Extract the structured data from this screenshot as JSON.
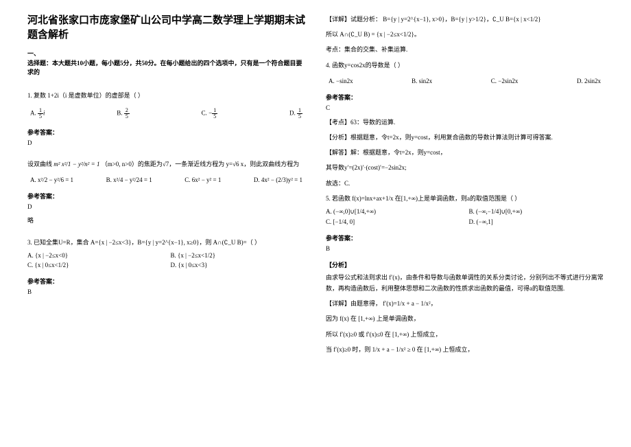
{
  "title": "河北省张家口市庞家堡矿山公司中学高二数学理上学期期末试题含解析",
  "section1": {
    "num": "一、",
    "text": "选择题：本大题共10小题，每小题5分，共50分。在每小题给出的四个选项中，只有是一个符合题目要求的"
  },
  "q1": {
    "stem": "1. 复数 1+2i（i 是虚数单位）的虚部是（    ）",
    "A": "1/5 i",
    "B": "2/5",
    "C": "−1/5",
    "D": "1/5",
    "ans_label": "参考答案：",
    "ans": "D"
  },
  "q2": {
    "stem_pre": "设双曲线",
    "stem_mid": "（m>0, n>0）的焦距为√7，一条渐近线方程为 y=√6 x，则此双曲线方程为",
    "A": "A.  x²/2 − y²/6 = 1",
    "B": "B.  x²/4 − y²/24 = 1",
    "C": "C.  6x² − y² = 1",
    "D": "D.  4x² − (2/3)y² = 1",
    "ans_label": "参考答案：",
    "ans": "D",
    "note": "略"
  },
  "q3": {
    "stem": "3. 已知全集U=R，集合 A={x | −2≤x<3}，B={y | y=2^{x−1}, x≥0}，则 A∩(∁_U B)=（  ）",
    "A": "A.  {x | −2≤x<0}",
    "B": "B.  {x | −2≤x<1/2}",
    "C": "C.  {x | 0≤x<1/2}",
    "D": "D.  {x | 0≤x<3}",
    "ans_label": "参考答案：",
    "ans": "B"
  },
  "right": {
    "detail_label": "【详解】试题分析：",
    "detail_text": "B={y | y=2^{x−1}, x>0}，B={y | y>1/2}，∁_U B={x | x<1/2}",
    "so": "所以 A∩(∁_U B) = {x | −2≤x<1/2}。",
    "point": "考点：集合的交集、补集运算."
  },
  "q4": {
    "stem": "4. 函数y=cos2x的导数是（    ）",
    "A": "A.  −sin2x",
    "B": "B.  sin2x",
    "C": "C.  −2sin2x",
    "D": "D.  2sin2x",
    "ans_label": "参考答案：",
    "ans": "C",
    "topic": "【考点】63：导数的运算.",
    "analysis": "【分析】根据题意，令t=2x，则y=cost，利用复合函数的导数计算法则计算可得答案.",
    "solve1": "【解答】解：根据题意，令t=2x，则y=cost，",
    "solve2": "其导数y′=(2x)′·(cost)′=−2sin2x;",
    "solve3": "故选：C."
  },
  "q5": {
    "stem": "5. 若函数 f(x)=lnx+ax+1/x 在[1,+∞)上是单调函数，则a的取值范围是（   ）",
    "A": "A.  (−∞,0]∪[1/4,+∞)",
    "B": "B.  (−∞,−1/4]∪[0,+∞)",
    "C": "C.  [−1/4, 0]",
    "D": "D.  (−∞,1]",
    "ans_label": "参考答案：",
    "ans": "B",
    "ana_label": "【分析】",
    "ana_text": "由求导公式和法则求出 f′(x)，由条件和导数与函数单调性的关系分类讨论，分别列出不等式进行分离常数，再构造函数后，利用整体思想和二次函数的性质求出函数的最值，可得a的取值范围.",
    "det_label": "【详解】由题意得，",
    "det_eq": "f′(x)=1/x + a − 1/x²，",
    "det1": "因为 f(x) 在 [1,+∞) 上是单调函数，",
    "det2": "所以 f′(x)≥0 或 f′(x)≤0 在 [1,+∞) 上恒成立，",
    "det3": "当 f′(x)≥0 时，则 1/x + a − 1/x² ≥ 0 在 [1,+∞) 上恒成立，"
  }
}
